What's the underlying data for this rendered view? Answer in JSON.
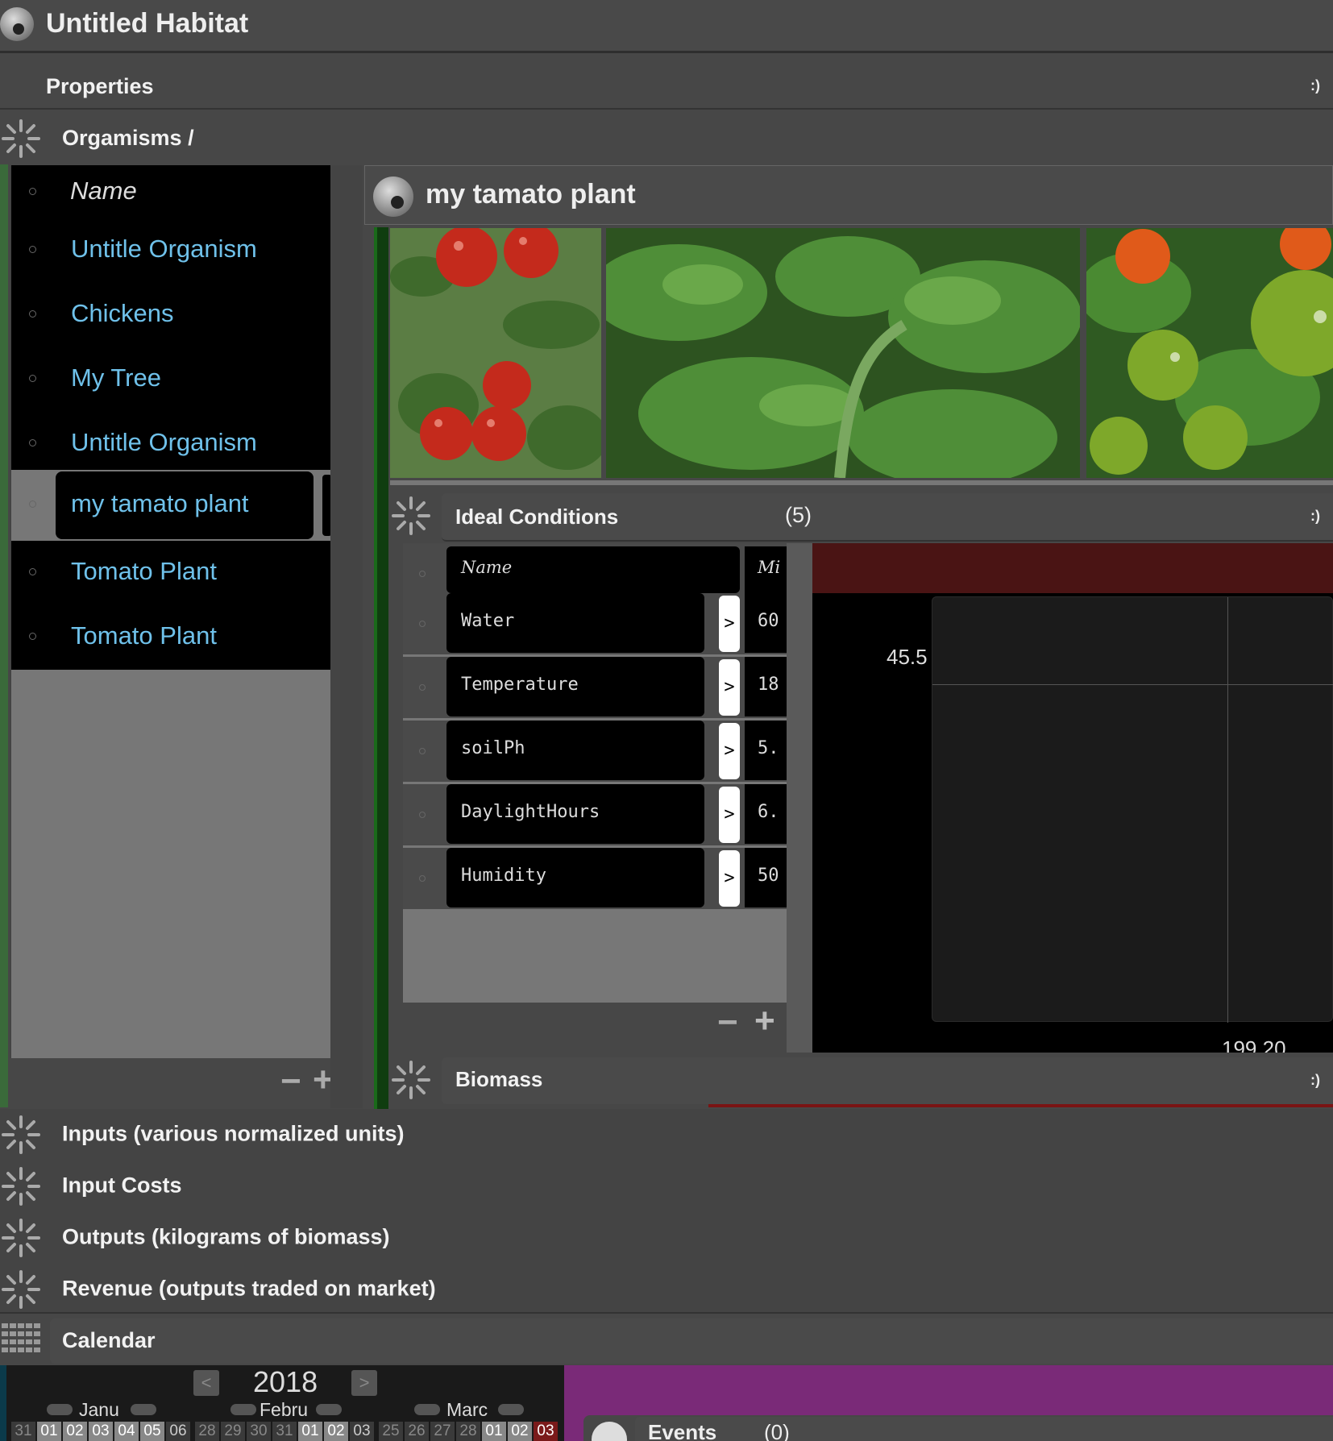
{
  "window": {
    "title": "Untitled Habitat"
  },
  "properties": {
    "label": "Properties",
    "corner": ":)"
  },
  "organisms": {
    "breadcrumb": "Orgamisms /",
    "header": "Name",
    "items": [
      {
        "label": "Untitle Organism"
      },
      {
        "label": "Chickens"
      },
      {
        "label": "My Tree"
      },
      {
        "label": "Untitle Organism"
      },
      {
        "label": "my tamato plant",
        "selected": true
      },
      {
        "label": "Tomato Plant"
      },
      {
        "label": "Tomato Plant"
      }
    ],
    "minus": "−",
    "plus": "+"
  },
  "detail": {
    "title": "my tamato plant",
    "photos": [
      "tomato-cluster-photo",
      "tomato-leaves-photo",
      "tomato-green-fruit-photo"
    ]
  },
  "ideal_conditions": {
    "label": "Ideal Conditions",
    "count": "(5)",
    "corner": ":)",
    "header_name": "Name",
    "header_min": "Mi",
    "rows": [
      {
        "name": "Water",
        "arrow": ">",
        "min": "60"
      },
      {
        "name": "Temperature",
        "arrow": ">",
        "min": "18"
      },
      {
        "name": "soilPh",
        "arrow": ">",
        "min": "5."
      },
      {
        "name": "DaylightHours",
        "arrow": ">",
        "min": "6."
      },
      {
        "name": "Humidity",
        "arrow": ">",
        "min": "50"
      }
    ],
    "minus": "−",
    "plus": "+",
    "chart": {
      "y_label": "45.5",
      "x_label": "199.20"
    }
  },
  "biomass": {
    "label": "Biomass",
    "corner": ":)"
  },
  "sections": [
    {
      "label": "Inputs (various normalized units)"
    },
    {
      "label": "Input Costs"
    },
    {
      "label": "Outputs (kilograms of biomass)"
    },
    {
      "label": "Revenue (outputs traded on market)"
    }
  ],
  "calendar": {
    "label": "Calendar",
    "year": "2018",
    "prev": "<",
    "next": ">",
    "months": [
      "Janu",
      "Febru",
      "Marc"
    ],
    "days": [
      "31",
      "01",
      "02",
      "03",
      "04",
      "05",
      "06",
      "28",
      "29",
      "30",
      "31",
      "01",
      "02",
      "03",
      "25",
      "26",
      "27",
      "28",
      "01",
      "02",
      "03"
    ]
  },
  "events": {
    "label": "Events",
    "count": "(0)"
  }
}
